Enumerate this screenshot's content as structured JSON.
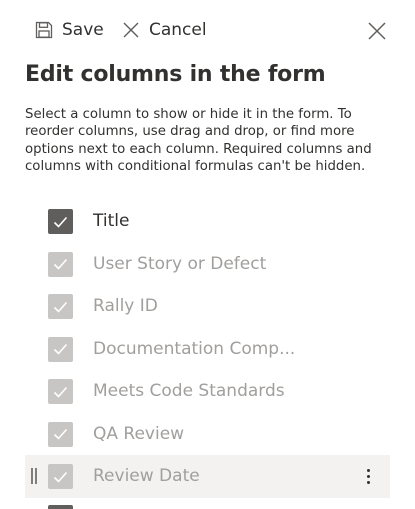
{
  "toolbar": {
    "save_label": "Save",
    "cancel_label": "Cancel"
  },
  "header": {
    "title": "Edit columns in the form"
  },
  "description": "Select a column to show or hide it in the form. To reorder columns, use drag and drop, or find more options next to each column. Required columns and columns with conditional formulas can't be hidden.",
  "columns": [
    {
      "label": "Title",
      "checked": true,
      "enabled": true
    },
    {
      "label": "User Story or Defect",
      "checked": true,
      "enabled": false
    },
    {
      "label": "Rally ID",
      "checked": true,
      "enabled": false
    },
    {
      "label": "Documentation Comp...",
      "checked": true,
      "enabled": false
    },
    {
      "label": "Meets Code Standards",
      "checked": true,
      "enabled": false
    },
    {
      "label": "QA Review",
      "checked": true,
      "enabled": false
    },
    {
      "label": "Review Date",
      "checked": true,
      "enabled": false,
      "hovered": true
    }
  ],
  "colors": {
    "checkbox_active": "#605e5c",
    "checkbox_disabled": "#c8c6c4",
    "text_primary": "#323130",
    "text_disabled": "#a19f9d",
    "row_hover": "#f3f2f1"
  },
  "icons": {
    "save": "floppy-disk-icon",
    "cancel": "x-icon",
    "close": "close-icon",
    "check": "checkmark-icon",
    "drag": "gripper-icon",
    "more": "more-vertical-icon"
  }
}
